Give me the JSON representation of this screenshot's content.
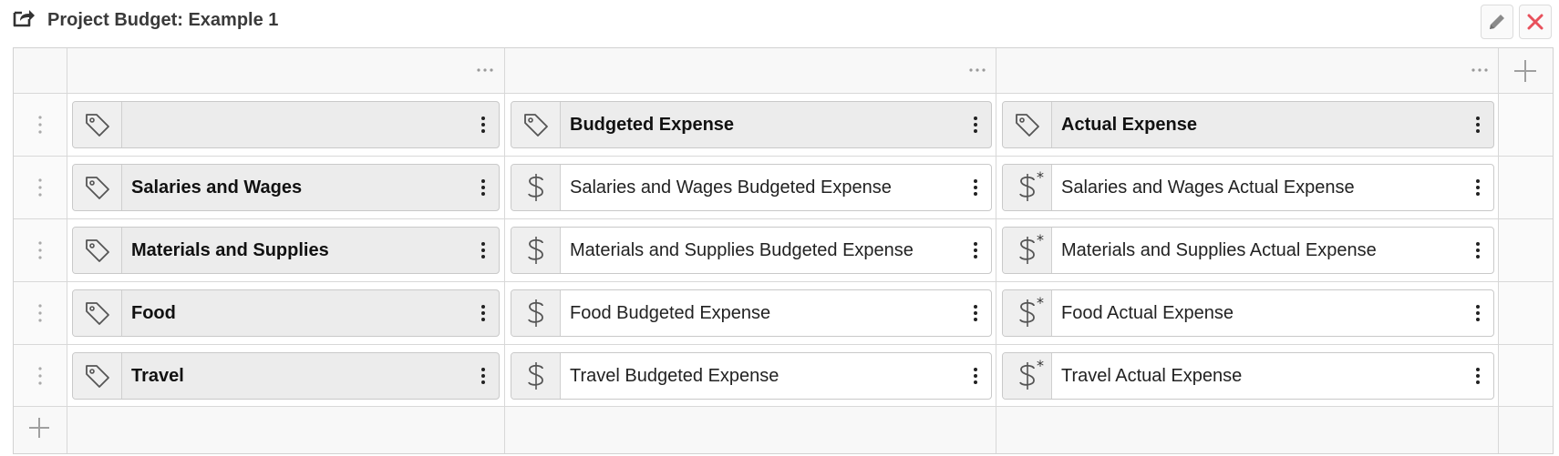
{
  "header": {
    "title": "Project Budget: Example 1",
    "share_icon": "share-external-icon",
    "edit_icon": "pencil-icon",
    "close_icon": "close-icon"
  },
  "colors": {
    "close": "#e8505b",
    "icon": "#555555",
    "border": "#d2d2d2"
  },
  "grid": {
    "column_menu_icon": "more-horizontal-icon",
    "add_column_icon": "plus-icon",
    "add_row_icon": "plus-icon",
    "row_handle_icon": "drag-vertical-dots-icon",
    "header_row": {
      "cells": [
        {
          "label": "",
          "icon": "tag-icon"
        },
        {
          "label": "Budgeted Expense",
          "icon": "tag-icon"
        },
        {
          "label": "Actual Expense",
          "icon": "tag-icon"
        }
      ]
    },
    "rows": [
      {
        "label": "Salaries and Wages",
        "budgeted": "Salaries and Wages Budgeted Expense",
        "actual": "Salaries and Wages Actual Expense"
      },
      {
        "label": "Materials and Supplies",
        "budgeted": "Materials and Supplies Budgeted Expense",
        "actual": "Materials and Supplies Actual Expense"
      },
      {
        "label": "Food",
        "budgeted": "Food Budgeted Expense",
        "actual": "Food Actual Expense"
      },
      {
        "label": "Travel",
        "budgeted": "Travel Budgeted Expense",
        "actual": "Travel Actual Expense"
      }
    ],
    "actual_marker": "*"
  }
}
